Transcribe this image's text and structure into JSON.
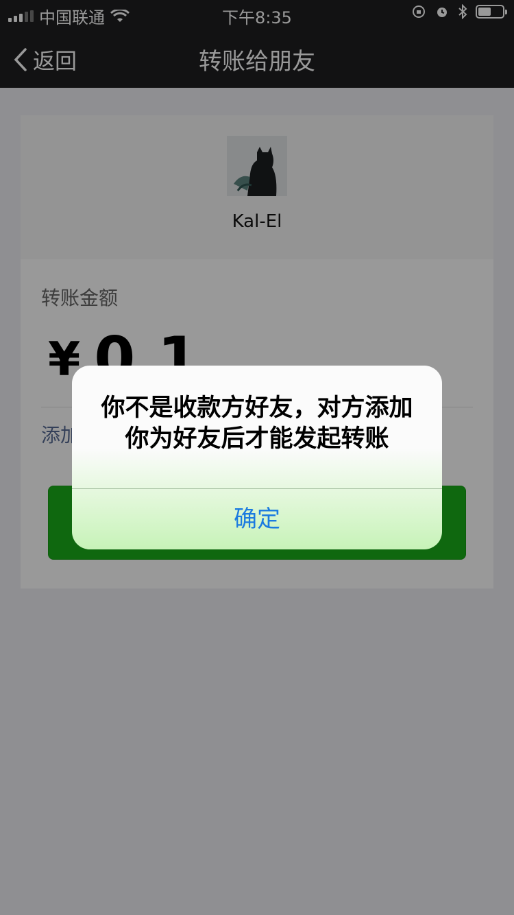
{
  "status_bar": {
    "carrier": "中国联通",
    "time": "下午8:35",
    "icons": [
      "signal-icon",
      "wifi-icon",
      "lock-rotation-icon",
      "alarm-icon",
      "bluetooth-icon",
      "battery-icon"
    ]
  },
  "nav": {
    "back_label": "返回",
    "title": "转账给朋友"
  },
  "recipient": {
    "name": "Kal-El"
  },
  "transfer": {
    "amount_label": "转账金额",
    "currency_symbol": "¥",
    "amount_visible": "0.1",
    "note_link_partial": "添加"
  },
  "dialog": {
    "message": "你不是收款方好友，对方添加你为好友后才能发起转账",
    "confirm_label": "确定"
  },
  "colors": {
    "nav_background": "#1f1f21",
    "primary_green": "#1aad19",
    "link_blue": "#1a7ae0"
  }
}
